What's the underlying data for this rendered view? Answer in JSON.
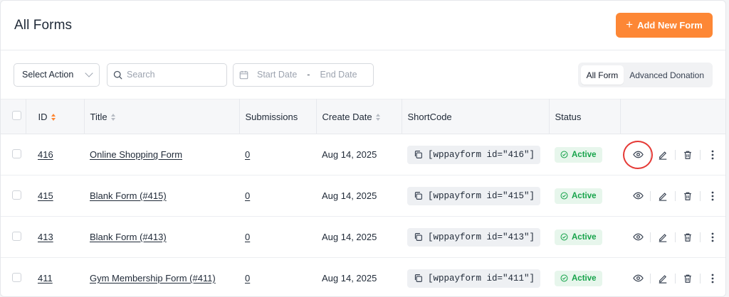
{
  "header": {
    "title": "All Forms",
    "add_button_label": "Add New Form"
  },
  "toolbar": {
    "select_action": "Select Action",
    "search_placeholder": "Search",
    "start_date_placeholder": "Start Date",
    "end_date_placeholder": "End Date",
    "date_separator": "-",
    "filters": [
      {
        "label": "All Form",
        "active": true
      },
      {
        "label": "Advanced Donation",
        "active": false
      }
    ]
  },
  "table": {
    "columns": {
      "id": "ID",
      "title": "Title",
      "submissions": "Submissions",
      "create_date": "Create Date",
      "shortcode": "ShortCode",
      "status": "Status"
    },
    "rows": [
      {
        "id": "416",
        "title": "Online Shopping Form",
        "submissions": "0",
        "create_date": "Aug 14, 2025",
        "shortcode": "[wppayform id=\"416\"]",
        "status": "Active"
      },
      {
        "id": "415",
        "title": "Blank Form (#415)",
        "submissions": "0",
        "create_date": "Aug 14, 2025",
        "shortcode": "[wppayform id=\"415\"]",
        "status": "Active"
      },
      {
        "id": "413",
        "title": "Blank Form (#413)",
        "submissions": "0",
        "create_date": "Aug 14, 2025",
        "shortcode": "[wppayform id=\"413\"]",
        "status": "Active"
      },
      {
        "id": "411",
        "title": "Gym Membership Form (#411)",
        "submissions": "0",
        "create_date": "Aug 14, 2025",
        "shortcode": "[wppayform id=\"411\"]",
        "status": "Active"
      }
    ]
  },
  "colors": {
    "accent": "#fd8735",
    "active_green": "#16a34a",
    "highlight_ring": "#e53935"
  },
  "icons": [
    "plus-icon",
    "chevron-down-icon",
    "search-icon",
    "calendar-icon",
    "sort-icon",
    "copy-icon",
    "check-circle-icon",
    "eye-icon",
    "edit-icon",
    "trash-icon",
    "more-vertical-icon"
  ]
}
